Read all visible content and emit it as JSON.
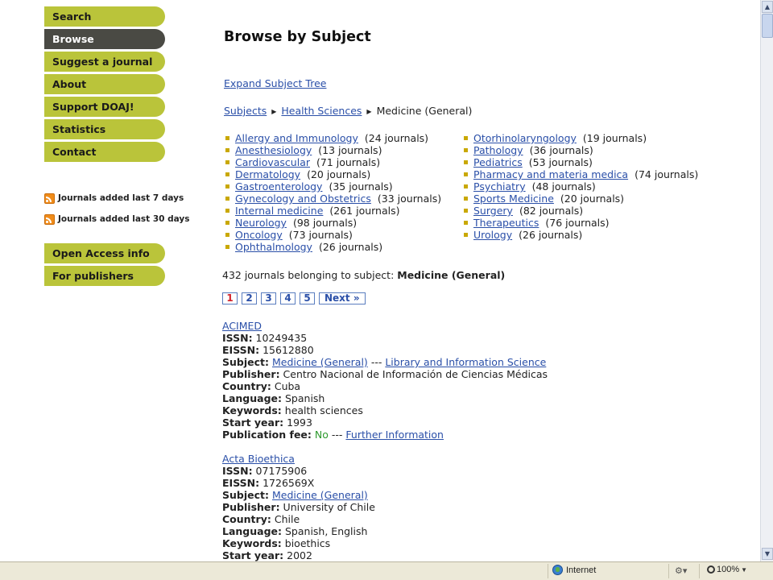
{
  "sidebar": {
    "nav_primary": [
      "Search",
      "Browse",
      "Suggest a journal",
      "About",
      "Support DOAJ!",
      "Statistics",
      "Contact"
    ],
    "active_item": "Browse",
    "feeds": [
      "Journals added last 7 days",
      "Journals added last 30 days"
    ],
    "nav_secondary": [
      "Open Access info",
      "For publishers"
    ]
  },
  "main": {
    "title": "Browse by Subject",
    "expand_link": "Expand Subject Tree",
    "breadcrumb": {
      "level1": "Subjects",
      "level2": "Health Sciences",
      "current": "Medicine (General)"
    },
    "subjects_left": [
      {
        "name": "Allergy and Immunology",
        "count": "(24 journals)"
      },
      {
        "name": "Anesthesiology",
        "count": "(13 journals)"
      },
      {
        "name": "Cardiovascular",
        "count": "(71 journals)"
      },
      {
        "name": "Dermatology",
        "count": "(20 journals)"
      },
      {
        "name": "Gastroenterology",
        "count": "(35 journals)"
      },
      {
        "name": "Gynecology and Obstetrics",
        "count": "(33 journals)"
      },
      {
        "name": "Internal medicine",
        "count": "(261 journals)"
      },
      {
        "name": "Neurology",
        "count": "(98 journals)"
      },
      {
        "name": "Oncology",
        "count": "(73 journals)"
      },
      {
        "name": "Ophthalmology",
        "count": "(26 journals)"
      }
    ],
    "subjects_right": [
      {
        "name": "Otorhinolaryngology",
        "count": "(19 journals)"
      },
      {
        "name": "Pathology",
        "count": "(36 journals)"
      },
      {
        "name": "Pediatrics",
        "count": "(53 journals)"
      },
      {
        "name": "Pharmacy and materia medica",
        "count": "(74 journals)"
      },
      {
        "name": "Psychiatry",
        "count": "(48 journals)"
      },
      {
        "name": "Sports Medicine",
        "count": "(20 journals)"
      },
      {
        "name": "Surgery",
        "count": "(82 journals)"
      },
      {
        "name": "Therapeutics",
        "count": "(76 journals)"
      },
      {
        "name": "Urology",
        "count": "(26 journals)"
      }
    ],
    "summary_prefix": "432 journals belonging to subject:",
    "summary_subject": "Medicine (General)",
    "pagination": {
      "pages": [
        "1",
        "2",
        "3",
        "4",
        "5"
      ],
      "current": "1",
      "next_label": "Next »"
    },
    "journals": [
      {
        "title": "ACIMED",
        "issn": "10249435",
        "eissn": "15612880",
        "subjects": [
          "Medicine (General)",
          "Library and Information Science"
        ],
        "separator": "---",
        "publisher": "Centro Nacional de Información de Ciencias Médicas",
        "country": "Cuba",
        "language": "Spanish",
        "keywords": "health sciences",
        "start_year": "1993",
        "publication_fee": "No",
        "further_info": "Further Information"
      },
      {
        "title": "Acta Bioethica",
        "issn": "07175906",
        "eissn": "1726569X",
        "subjects": [
          "Medicine (General)"
        ],
        "publisher": "University of Chile",
        "country": "Chile",
        "language": "Spanish, English",
        "keywords": "bioethics",
        "start_year": "2002"
      }
    ],
    "field_labels": {
      "issn": "ISSN",
      "eissn": "EISSN",
      "subject": "Subject",
      "publisher": "Publisher",
      "country": "Country",
      "language": "Language",
      "keywords": "Keywords",
      "start_year": "Start year",
      "publication_fee": "Publication fee"
    }
  },
  "statusbar": {
    "zone": "Internet",
    "zoom": "100%"
  },
  "colors": {
    "nav_bg": "#bac43a",
    "nav_active_bg": "#4a4a44",
    "link": "#2a4fa8",
    "bullet": "#c9a800",
    "current_page": "#d2232a",
    "fee_no": "#2e9a2e"
  },
  "icons": [
    "rss-icon",
    "globe-icon",
    "zoom-icon",
    "scroll-up-icon",
    "scroll-down-icon"
  ]
}
